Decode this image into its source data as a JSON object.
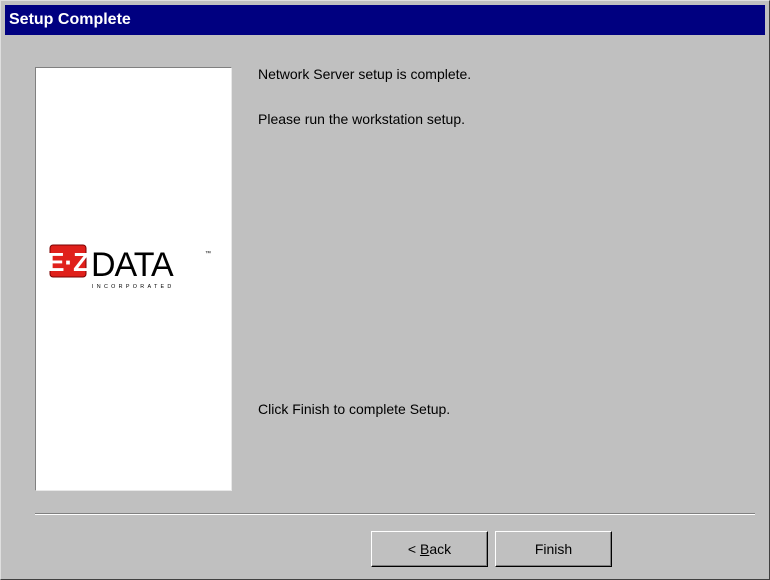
{
  "window": {
    "title": "Setup Complete"
  },
  "image_panel": {
    "logo": {
      "brand_mark": "E·Z",
      "brand_word": "DATA",
      "tagline": "INCORPORATED",
      "mark_color": "#e0201b"
    }
  },
  "messages": {
    "line1": "Network Server setup is complete.",
    "line2": "Please run the workstation setup.",
    "line3": "Click Finish to complete Setup."
  },
  "buttons": {
    "back": {
      "prefix": "< ",
      "mnemonic": "B",
      "rest": "ack"
    },
    "finish": "Finish"
  }
}
